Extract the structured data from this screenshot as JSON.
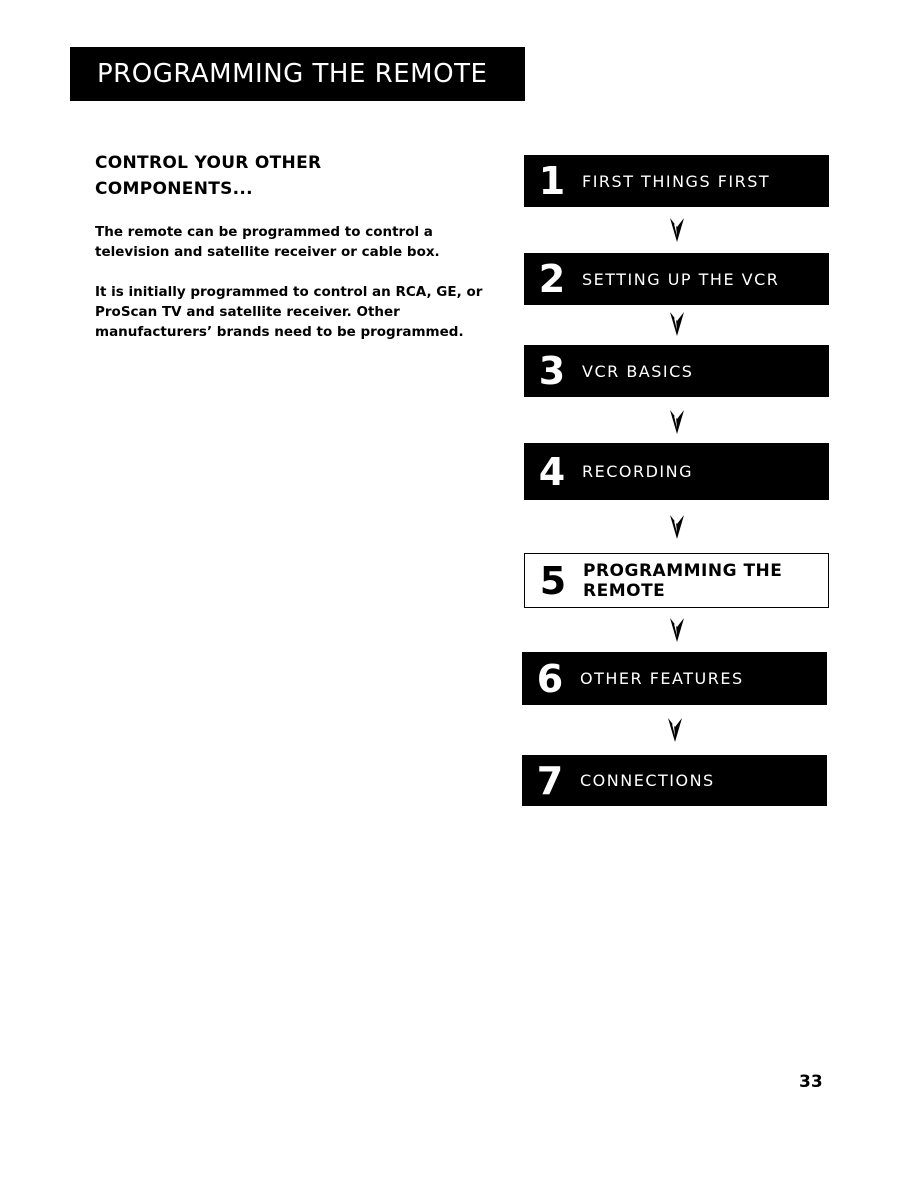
{
  "header": {
    "title": "PROGRAMMING THE REMOTE"
  },
  "content": {
    "heading_line1": "CONTROL YOUR OTHER",
    "heading_line2": "COMPONENTS...",
    "paragraphs": [
      "The remote can be programmed to control a television and satellite receiver or cable box.",
      "It is initially programmed to control an RCA, GE, or ProScan TV and satellite receiver. Other manufacturers’ brands need to be programmed."
    ]
  },
  "steps": [
    {
      "number": "1",
      "label": "FIRST THINGS FIRST",
      "current": false
    },
    {
      "number": "2",
      "label": "SETTING UP THE VCR",
      "current": false
    },
    {
      "number": "3",
      "label": "VCR BASICS",
      "current": false
    },
    {
      "number": "4",
      "label": "RECORDING",
      "current": false
    },
    {
      "number": "5",
      "label": "PROGRAMMING THE REMOTE",
      "current": true
    },
    {
      "number": "6",
      "label": "OTHER FEATURES",
      "current": false
    },
    {
      "number": "7",
      "label": "CONNECTIONS",
      "current": false
    }
  ],
  "footer": {
    "page_number": "33"
  }
}
